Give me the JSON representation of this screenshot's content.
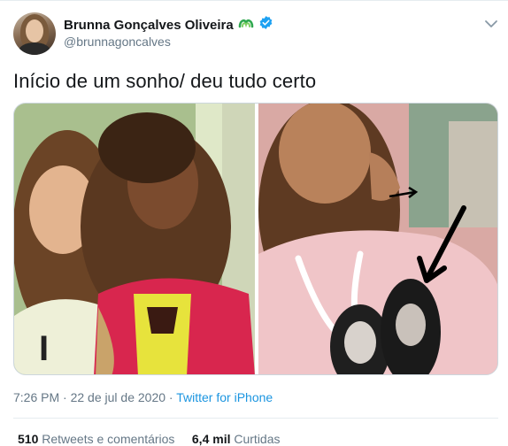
{
  "author": {
    "display_name": "Brunna Gonçalves Oliveira",
    "handle": "@brunnagoncalves",
    "badge_icon": "rainbow-heart-icon",
    "verified_icon": "verified-badge-icon"
  },
  "tweet": {
    "text": "Início de um sonho/ deu tudo certo"
  },
  "media": {
    "photo_count": 2
  },
  "meta": {
    "time": "7:26 PM",
    "separator": " · ",
    "date": "22 de jul de 2020",
    "source": "Twitter for iPhone"
  },
  "stats": {
    "retweets_count": "510",
    "retweets_label": "Retweets e comentários",
    "likes_count": "6,4 mil",
    "likes_label": "Curtidas"
  },
  "colors": {
    "link": "#1b95e0",
    "secondary_text": "#657786",
    "primary_text": "#14171a",
    "verified": "#1da1f2"
  }
}
